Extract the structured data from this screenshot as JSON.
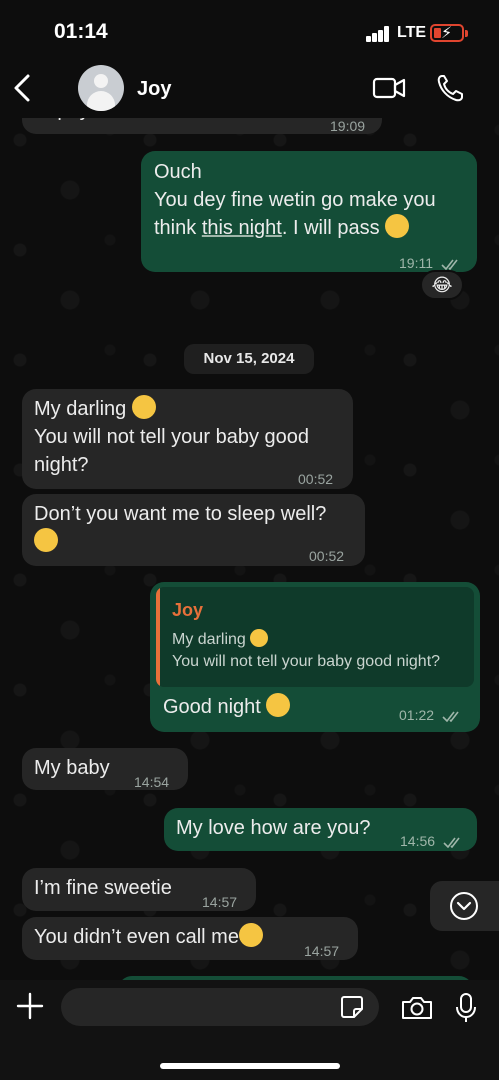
{
  "status_bar": {
    "time": "01:14",
    "network": "LTE"
  },
  "header": {
    "contact_name": "Joy"
  },
  "messages": {
    "m0": {
      "text": "trophy",
      "time": "19:09"
    },
    "m1": {
      "line1": "Ouch",
      "line2": "You dey fine wetin go make you",
      "line3a": "think ",
      "line3_link": "this night",
      "line3b": ". I will pass",
      "time": "19:11",
      "reaction": "😂"
    },
    "date_separator": "Nov 15, 2024",
    "m2": {
      "line1": "My darling",
      "line2": "You will not tell your baby good",
      "line3": "night?",
      "time": "00:52"
    },
    "m3": {
      "line1": "Don’t you want me to sleep well?",
      "time": "00:52"
    },
    "m4": {
      "quote_name": "Joy",
      "quote_line1": "My darling",
      "quote_line2": "You will not tell your baby good night?",
      "text": "Good night",
      "time": "01:22"
    },
    "m5": {
      "text": "My baby",
      "time": "14:54"
    },
    "m6": {
      "text": "My love how are you?",
      "time": "14:56"
    },
    "m7": {
      "text": "I’m fine sweetie",
      "time": "14:57"
    },
    "m8": {
      "text": "You didn’t even call me",
      "time": "14:57"
    }
  },
  "composer": {
    "placeholder": ""
  },
  "colors": {
    "outgoing": "#144d37",
    "incoming": "#262626",
    "reply_accent": "#e8703a",
    "battery": "#e0452f"
  },
  "icons": [
    "back-icon",
    "video-call-icon",
    "phone-icon",
    "plus-icon",
    "sticker-icon",
    "camera-icon",
    "microphone-icon",
    "chevron-down-icon",
    "read-ticks-icon"
  ]
}
